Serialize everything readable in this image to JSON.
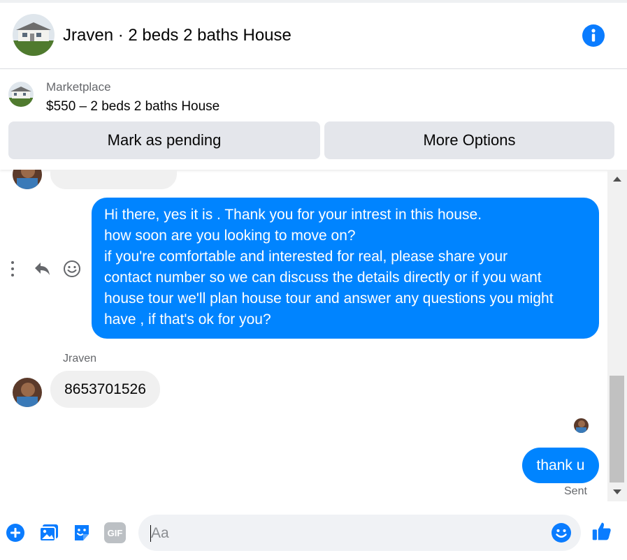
{
  "header": {
    "title": "Jraven · 2 beds 2 baths House",
    "info_icon": "info-icon"
  },
  "marketplace": {
    "label": "Marketplace",
    "listing": "$550 – 2 beds 2 baths House",
    "mark_pending_label": "Mark as pending",
    "more_options_label": "More Options"
  },
  "conversation": {
    "messages": [
      {
        "from": "me",
        "lines": [
          "Hi there, yes it is . Thank you for your intrest in this house.",
          "how soon are you looking to move on?",
          "if you're comfortable and interested for real, please share your",
          "contact number so we can discuss the details directly or if you  want",
          "house tour we'll plan house tour and answer any questions you might",
          "have , if that's ok for you?"
        ]
      },
      {
        "from": "them",
        "sender": "Jraven",
        "text": "8653701526"
      },
      {
        "from": "me",
        "text": "thank u",
        "status": "Sent"
      }
    ],
    "actions": [
      "more-icon",
      "reply-icon",
      "react-icon"
    ]
  },
  "composer": {
    "placeholder": "Aa",
    "icons": [
      "add-icon",
      "photo-icon",
      "sticker-icon",
      "gif-icon",
      "emoji-icon",
      "like-icon"
    ],
    "gif_text": "GIF"
  },
  "colors": {
    "accent": "#0084ff",
    "icon_blue": "#0a7cff",
    "bubble_gray": "#f0f0f0",
    "button_gray": "#e4e6eb"
  }
}
